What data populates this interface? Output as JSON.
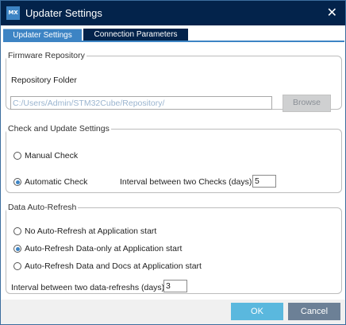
{
  "window": {
    "logo_text": "MX",
    "title": "Updater Settings",
    "close_glyph": "✕"
  },
  "tabs": [
    {
      "label": "Updater Settings",
      "active": true
    },
    {
      "label": "Connection Parameters",
      "active": false
    }
  ],
  "firmware_repository": {
    "legend": "Firmware Repository",
    "folder_label": "Repository Folder",
    "folder_value": "C:/Users/Admin/STM32Cube/Repository/",
    "browse_label": "Browse"
  },
  "check_update": {
    "legend": "Check and Update Settings",
    "manual_label": "Manual Check",
    "automatic_label": "Automatic Check",
    "selected": "automatic",
    "interval_label": "Interval between two Checks (days)",
    "interval_value": "5"
  },
  "auto_refresh": {
    "legend": "Data Auto-Refresh",
    "options": [
      {
        "label": "No Auto-Refresh at Application start",
        "checked": false
      },
      {
        "label": "Auto-Refresh Data-only at Application start",
        "checked": true
      },
      {
        "label": "Auto-Refresh Data and Docs at Application start",
        "checked": false
      }
    ],
    "interval_label": "Interval between two data-refreshs (days)",
    "interval_value": "3"
  },
  "footer": {
    "ok_label": "OK",
    "cancel_label": "Cancel"
  },
  "colors": {
    "title_bar": "#03234b",
    "tab_active": "#3d84c4",
    "ok_button": "#5ab8de",
    "cancel_button": "#6c8096"
  }
}
